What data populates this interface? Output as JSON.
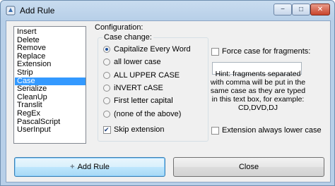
{
  "window": {
    "title": "Add Rule"
  },
  "controls": {
    "minimize": "−",
    "maximize": "□",
    "close": "✕"
  },
  "rules_list": [
    "Insert",
    "Delete",
    "Remove",
    "Replace",
    "Extension",
    "Strip",
    "Case",
    "Serialize",
    "CleanUp",
    "Translit",
    "RegEx",
    "PascalScript",
    "UserInput"
  ],
  "selected_rule": "Case",
  "config": {
    "label": "Configuration:",
    "case_group_title": "Case change:",
    "options": [
      "Capitalize Every Word",
      "all lower case",
      "ALL UPPER CASE",
      "iNVERT cASE",
      "First letter capital",
      "(none of the above)"
    ],
    "selected_option": "Capitalize Every Word",
    "skip_extension": {
      "label": "Skip extension",
      "checked": true
    },
    "force_case": {
      "label": "Force case for fragments:",
      "checked": false,
      "value": ""
    },
    "hint": "Hint: fragments separated with comma will be put in the same case as they are typed in this text box, for example: CD,DVD,DJ",
    "extension_lower": {
      "label": "Extension always lower case",
      "checked": false
    }
  },
  "buttons": {
    "add_rule": "Add Rule",
    "close": "Close"
  }
}
